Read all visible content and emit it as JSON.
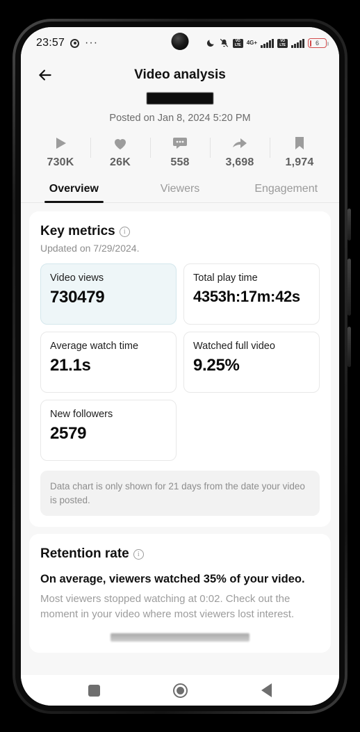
{
  "status_bar": {
    "time": "23:57",
    "overflow_dots": "···",
    "icons": [
      "target-icon",
      "more-dots-icon",
      "moon-icon",
      "mute-icon",
      "volte-icon",
      "network-4g-plus-icon",
      "signal-bars-icon",
      "volte-2-icon",
      "signal-bars-2-icon"
    ],
    "network_label": "4G+",
    "network_sub": "⁺",
    "volte_top": "VO",
    "volte_bottom": "LTE",
    "battery_level": "6"
  },
  "header": {
    "back_label": "back-arrow",
    "title": "Video analysis",
    "redacted_caption": "",
    "posted": "Posted on Jan 8, 2024 5:20 PM"
  },
  "stats": [
    {
      "icon": "play-icon",
      "value": "730K"
    },
    {
      "icon": "heart-icon",
      "value": "26K"
    },
    {
      "icon": "comment-icon",
      "value": "558"
    },
    {
      "icon": "share-icon",
      "value": "3,698"
    },
    {
      "icon": "bookmark-icon",
      "value": "1,974"
    }
  ],
  "tabs": [
    {
      "label": "Overview",
      "active": true
    },
    {
      "label": "Viewers",
      "active": false
    },
    {
      "label": "Engagement",
      "active": false
    }
  ],
  "key_metrics": {
    "title": "Key metrics",
    "info_icon": "info-icon",
    "updated": "Updated on 7/29/2024.",
    "metrics": [
      {
        "label": "Video views",
        "value": "730479",
        "selected": true
      },
      {
        "label": "Total play time",
        "value": "4353h:17m:42s",
        "selected": false
      },
      {
        "label": "Average watch time",
        "value": "21.1s",
        "selected": false
      },
      {
        "label": "Watched full video",
        "value": "9.25%",
        "selected": false
      },
      {
        "label": "New followers",
        "value": "2579",
        "selected": false
      }
    ],
    "notice": "Data chart is only shown for 21 days from the date your video is posted."
  },
  "retention": {
    "title": "Retention rate",
    "info_icon": "info-icon",
    "headline": "On average, viewers watched 35% of your video.",
    "description": "Most viewers stopped watching at 0:02. Check out the moment in your video where most viewers lost interest."
  },
  "nav_bar": {
    "recents": "recents-square-icon",
    "home": "home-circle-icon",
    "back": "back-triangle-icon"
  },
  "colors": {
    "accent_card": "#eef6f8",
    "accent_border": "#d4e7ec",
    "app_background": "#f7f7f7",
    "text_primary": "#111111",
    "text_muted": "#9a9a9a",
    "battery_warning": "#d24b4b"
  }
}
